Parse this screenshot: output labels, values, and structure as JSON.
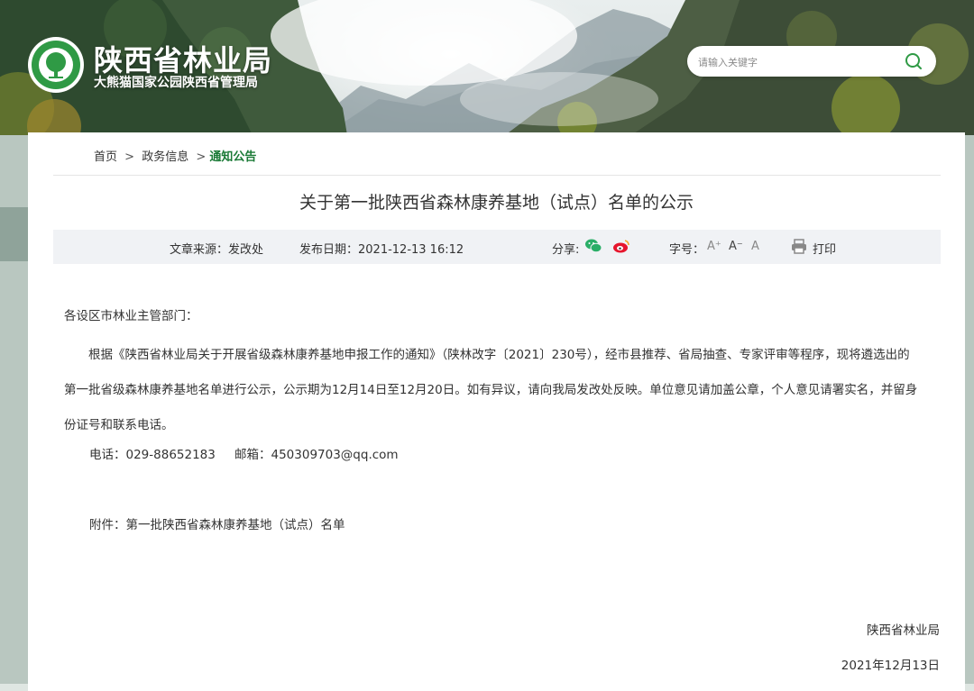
{
  "site": {
    "title": "陕西省林业局",
    "subtitle": "大熊猫国家公园陕西省管理局"
  },
  "search": {
    "placeholder": "请输入关键字"
  },
  "breadcrumb": {
    "home": "首页",
    "sep1": ">",
    "section": "政务信息",
    "sep2": ">",
    "current": "通知公告"
  },
  "article": {
    "title": "关于第一批陕西省森林康养基地（试点）名单的公示",
    "meta": {
      "source": "文章来源：发改处",
      "date": "发布日期：2021-12-13 16:12",
      "share_label": "分享:",
      "font_label": "字号：",
      "font_large": "A⁺",
      "font_small": "A⁻",
      "font_normal": "A",
      "print_label": "打印"
    },
    "salutation": "各设区市林业主管部门：",
    "paragraph_lines": [
      "根据《陕西省林业局关于开展省级森林康养基地申报工作的通知》（陕林改字〔2021〕230号），经市县推荐、省局抽查、专家评审等程序，现将遴选出的",
      "第一批省级森林康养基地名单进行公示，公示期为12月14日至12月20日。如有异议，请向我局发改处反映。单位意见请加盖公章，个人意见请署实名，并留身",
      "份证号和联系电话。"
    ],
    "phone": "电话：029-88652183",
    "email": "邮箱：450309703@qq.com",
    "attachment": "附件：第一批陕西省森林康养基地（试点）名单",
    "signature": "陕西省林业局",
    "sign_date": "2021年12月13日"
  },
  "colors": {
    "accent": "#1a7a36",
    "wechat": "#2aae67",
    "weibo": "#e6162d",
    "meta_bg": "#f0f2f5"
  },
  "icons": {
    "logo": "forest-emblem-logo",
    "search": "search-icon",
    "wechat": "wechat-icon",
    "weibo": "weibo-icon",
    "print": "printer-icon"
  }
}
